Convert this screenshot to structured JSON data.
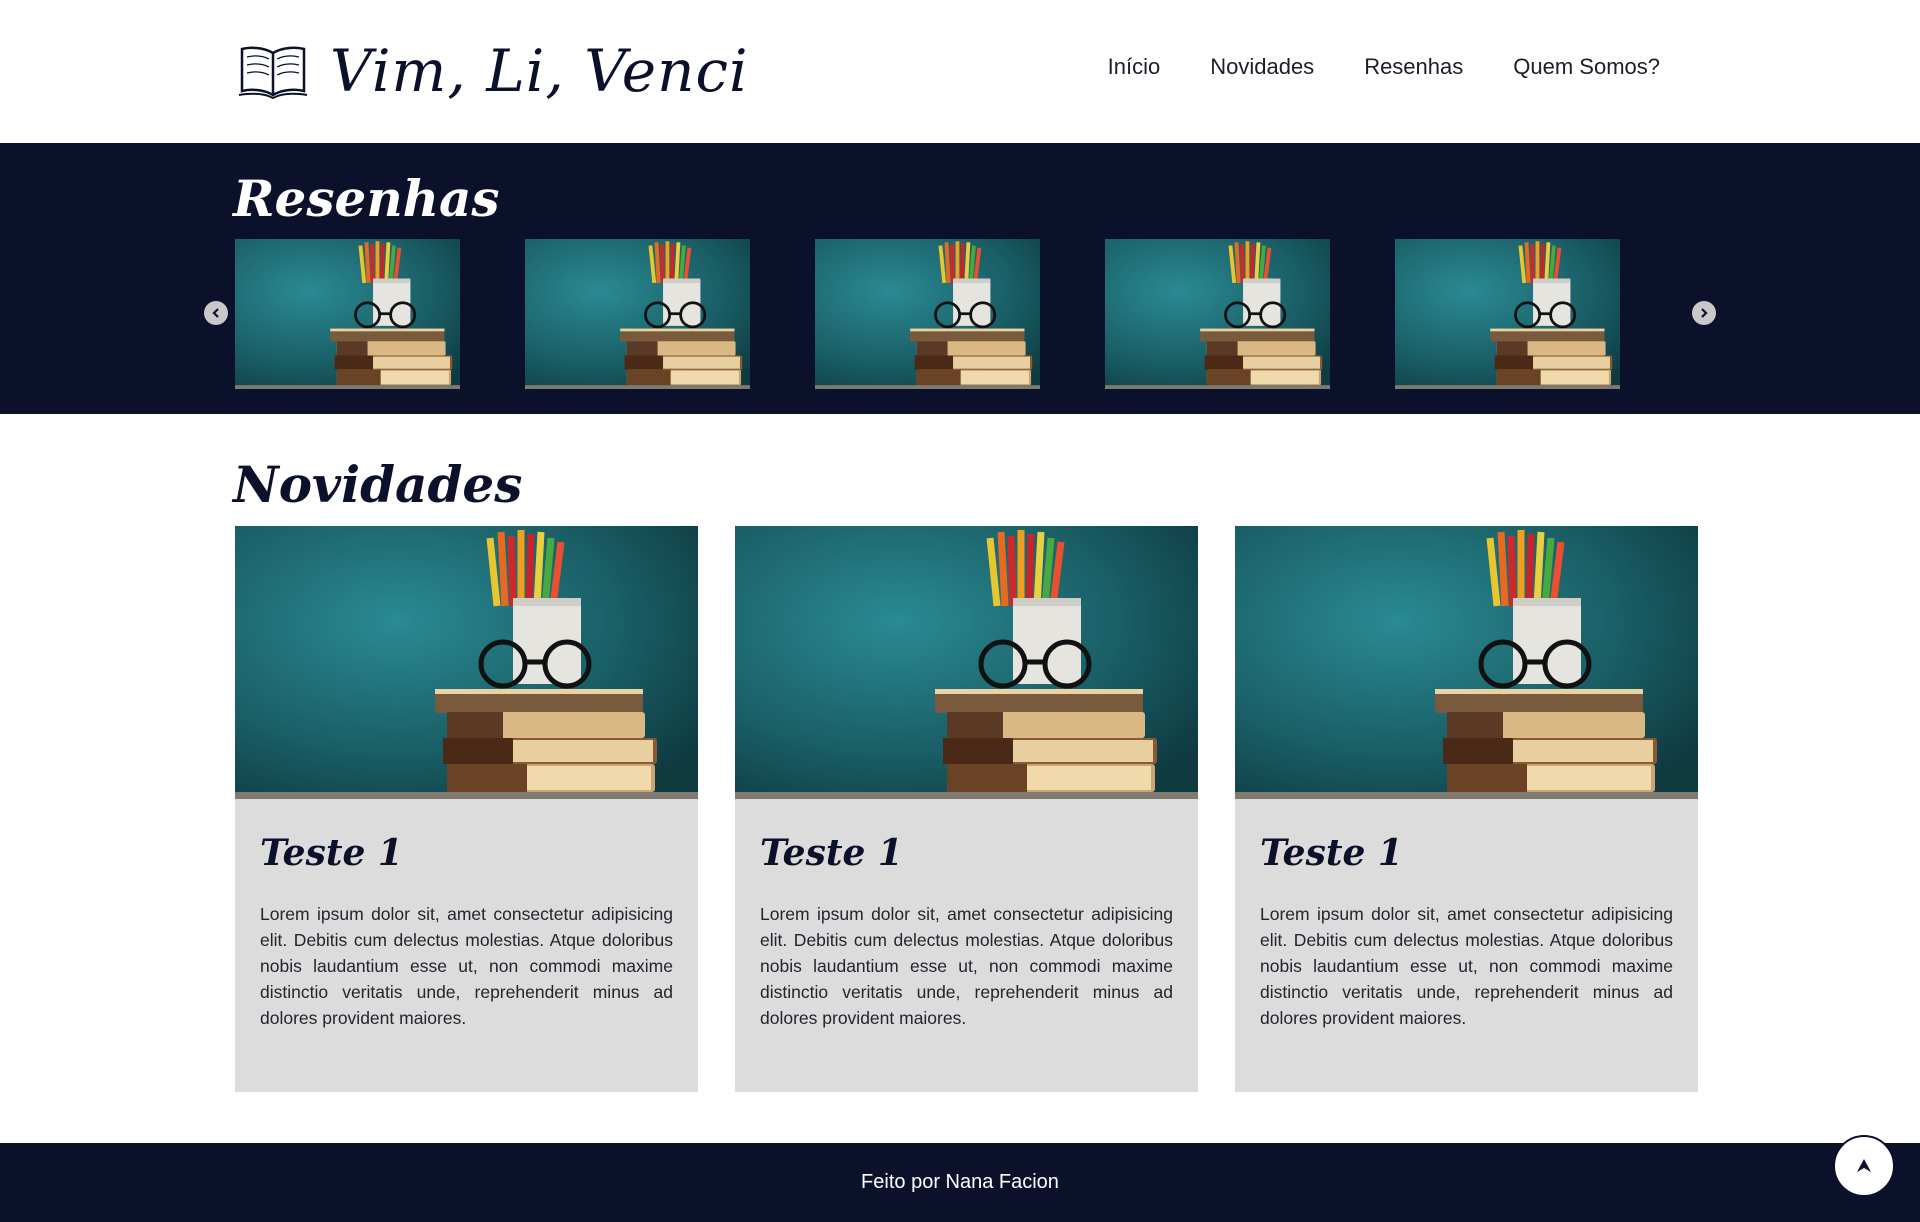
{
  "header": {
    "logo_text": "Vim, Li, Venci",
    "logo_icon": "open-book-icon",
    "nav": [
      {
        "label": "Início"
      },
      {
        "label": "Novidades"
      },
      {
        "label": "Resenhas"
      },
      {
        "label": "Quem Somos?"
      }
    ]
  },
  "reviews": {
    "title": "Resenhas",
    "prev_icon": "chevron-left-icon",
    "next_icon": "chevron-right-icon",
    "items": [
      {
        "image": "books-pencils-photo"
      },
      {
        "image": "books-pencils-photo"
      },
      {
        "image": "books-pencils-photo"
      },
      {
        "image": "books-pencils-photo"
      },
      {
        "image": "books-pencils-photo"
      }
    ]
  },
  "news": {
    "title": "Novidades",
    "cards": [
      {
        "title": "Teste 1",
        "text": "Lorem ipsum dolor sit, amet consectetur adipisicing elit. Debitis cum delectus molestias. Atque doloribus nobis laudantium esse ut, non commodi maxime distinctio veritatis unde, reprehenderit minus ad dolores provident maiores."
      },
      {
        "title": "Teste 1",
        "text": "Lorem ipsum dolor sit, amet consectetur adipisicing elit. Debitis cum delectus molestias. Atque doloribus nobis laudantium esse ut, non commodi maxime distinctio veritatis unde, reprehenderit minus ad dolores provident maiores."
      },
      {
        "title": "Teste 1",
        "text": "Lorem ipsum dolor sit, amet consectetur adipisicing elit. Debitis cum delectus molestias. Atque doloribus nobis laudantium esse ut, non commodi maxime distinctio veritatis unde, reprehenderit minus ad dolores provident maiores."
      }
    ]
  },
  "footer": {
    "text": "Feito por Nana Facion",
    "back_to_top_icon": "arrow-up-icon"
  },
  "colors": {
    "navy": "#0b112b",
    "card_bg": "#dcdcdc",
    "teal": "#1e6b73"
  }
}
